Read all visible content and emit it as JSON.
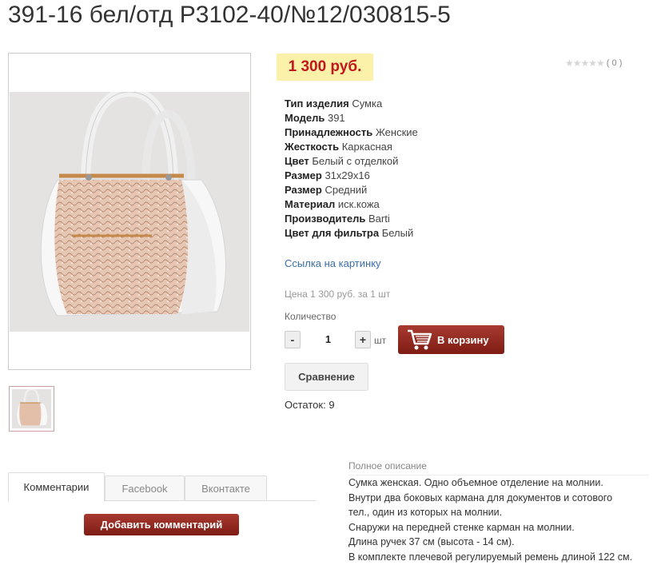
{
  "product": {
    "title": "391-16 бел/отд Р3102-40/№12/030815-5",
    "price": "1 300 руб.",
    "rating": {
      "stars": "★★★★★",
      "count": "( 0 )",
      "value": 0
    },
    "specs": [
      {
        "name": "Тип изделия",
        "value": "Сумка"
      },
      {
        "name": "Модель",
        "value": "391"
      },
      {
        "name": "Принадлежность",
        "value": "Женские"
      },
      {
        "name": "Жесткость",
        "value": "Каркасная"
      },
      {
        "name": "Цвет",
        "value": "Белый с отделкой"
      },
      {
        "name": "Размер",
        "value": "31х29х16"
      },
      {
        "name": "Размер",
        "value": "Средний"
      },
      {
        "name": "Материал",
        "value": "иск.кожа"
      },
      {
        "name": "Производитель",
        "value": "Barti"
      },
      {
        "name": "Цвет для фильтра",
        "value": "Белый"
      }
    ],
    "image_link": "Ссылка на картинку",
    "unit_price": "Цена 1 300 руб. за 1 шт",
    "quantity_label": "Количество",
    "quantity_value": "1",
    "decrease": "-",
    "increase": "+",
    "unit": "шт",
    "add_to_cart": "В корзину",
    "compare": "Сравнение",
    "stock": "Остаток: 9"
  },
  "tabs": [
    {
      "label": "Комментарии",
      "active": true
    },
    {
      "label": "Facebook",
      "active": false
    },
    {
      "label": "Вконтакте",
      "active": false
    }
  ],
  "add_comment": "Добавить комментарий",
  "description": {
    "title": "Полное описание",
    "lines": [
      "Сумка женская. Одно объемное отделение на молнии.",
      "Внутри два боковых кармана для документов и сотового",
      "тел., один из которых на молнии.",
      "Снаружи на передней стенке карман на молнии.",
      "Длина ручек 37 см (высота - 14 см).",
      "В комплекте плечевой регулируемый ремень длиной 122 см."
    ]
  },
  "colors": {
    "price_text": "#c0181c",
    "price_bg": "#fbf1a9",
    "button_primary": "#8e2a20",
    "link": "#3a6ea5"
  }
}
